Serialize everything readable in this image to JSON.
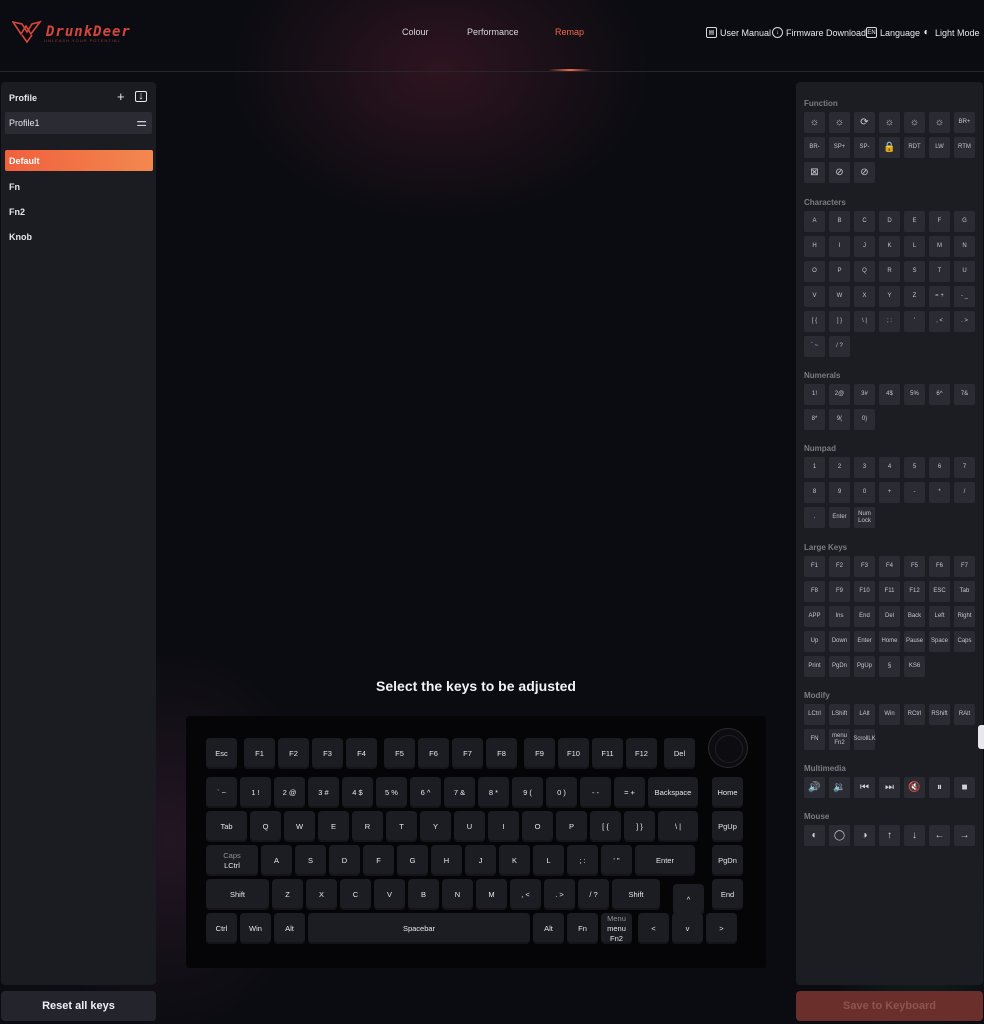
{
  "header": {
    "brand": "DrunkDeer",
    "tagline": "UNLEASH YOUR POTENTIAL",
    "nav": [
      {
        "label": "Colour",
        "active": false
      },
      {
        "label": "Performance",
        "active": false
      },
      {
        "label": "Remap",
        "active": true
      }
    ],
    "utilities": [
      {
        "label": "User Manual",
        "icon": "book-icon"
      },
      {
        "label": "Firmware Download",
        "icon": "download-icon"
      },
      {
        "label": "Language",
        "icon": "language-icon",
        "icon_text": "EN"
      },
      {
        "label": "Light Mode",
        "icon": "moon-icon"
      }
    ]
  },
  "profile": {
    "heading": "Profile",
    "selected": "Profile1",
    "layers": [
      {
        "label": "Default",
        "active": true
      },
      {
        "label": "Fn",
        "active": false
      },
      {
        "label": "Fn2",
        "active": false
      },
      {
        "label": "Knob",
        "active": false
      }
    ],
    "reset_label": "Reset all keys"
  },
  "main": {
    "title": "Select the keys to be adjusted"
  },
  "keyboard": {
    "rows": [
      [
        {
          "t": "Esc"
        },
        {
          "t": "F1"
        },
        {
          "t": "F2"
        },
        {
          "t": "F3"
        },
        {
          "t": "F4"
        },
        {
          "t": "F5"
        },
        {
          "t": "F6"
        },
        {
          "t": "F7"
        },
        {
          "t": "F8"
        },
        {
          "t": "F9"
        },
        {
          "t": "F10"
        },
        {
          "t": "F11"
        },
        {
          "t": "F12"
        },
        {
          "t": "Del"
        }
      ],
      [
        {
          "t": "` ~"
        },
        {
          "t": "1 !"
        },
        {
          "t": "2 @"
        },
        {
          "t": "3 #"
        },
        {
          "t": "4 $"
        },
        {
          "t": "5 %"
        },
        {
          "t": "6 ^"
        },
        {
          "t": "7 &"
        },
        {
          "t": "8 *"
        },
        {
          "t": "9 ("
        },
        {
          "t": "0 )"
        },
        {
          "t": "- -"
        },
        {
          "t": "= +"
        },
        {
          "t": "Backspace"
        },
        {
          "t": "Home"
        }
      ],
      [
        {
          "t": "Tab"
        },
        {
          "t": "Q"
        },
        {
          "t": "W"
        },
        {
          "t": "E"
        },
        {
          "t": "R"
        },
        {
          "t": "T"
        },
        {
          "t": "Y"
        },
        {
          "t": "U"
        },
        {
          "t": "I"
        },
        {
          "t": "O"
        },
        {
          "t": "P"
        },
        {
          "t": "[ {"
        },
        {
          "t": "] }"
        },
        {
          "t": "\\ |"
        },
        {
          "t": "PgUp"
        }
      ],
      [
        {
          "t": "Caps",
          "s": "LCtrl"
        },
        {
          "t": "A"
        },
        {
          "t": "S"
        },
        {
          "t": "D"
        },
        {
          "t": "F"
        },
        {
          "t": "G"
        },
        {
          "t": "H"
        },
        {
          "t": "J"
        },
        {
          "t": "K"
        },
        {
          "t": "L"
        },
        {
          "t": "; :"
        },
        {
          "t": "' \""
        },
        {
          "t": "Enter"
        },
        {
          "t": "PgDn"
        }
      ],
      [
        {
          "t": "Shift"
        },
        {
          "t": "Z"
        },
        {
          "t": "X"
        },
        {
          "t": "C"
        },
        {
          "t": "V"
        },
        {
          "t": "B"
        },
        {
          "t": "N"
        },
        {
          "t": "M"
        },
        {
          "t": ", <"
        },
        {
          "t": ". >"
        },
        {
          "t": "/ ?"
        },
        {
          "t": "Shift"
        },
        {
          "t": "^"
        },
        {
          "t": "End"
        }
      ],
      [
        {
          "t": "Ctrl"
        },
        {
          "t": "Win"
        },
        {
          "t": "Alt"
        },
        {
          "t": "Spacebar"
        },
        {
          "t": "Alt"
        },
        {
          "t": "Fn"
        },
        {
          "t": "Menu",
          "s": "menu Fn2"
        },
        {
          "t": "<"
        },
        {
          "t": "v"
        },
        {
          "t": ">"
        }
      ]
    ]
  },
  "palette": {
    "sections": [
      {
        "title": "Function",
        "keys": [
          {
            "icon": "brightness-icon",
            "g": "☼"
          },
          {
            "icon": "brightness-icon",
            "g": "☼"
          },
          {
            "icon": "cycle-icon",
            "g": "⟳"
          },
          {
            "icon": "brightness-icon",
            "g": "☼"
          },
          {
            "icon": "brightness-icon",
            "g": "☼"
          },
          {
            "icon": "brightness-icon",
            "g": "☼"
          },
          {
            "t": "BR+"
          },
          {
            "t": "BR-"
          },
          {
            "t": "SP+"
          },
          {
            "t": "SP-"
          },
          {
            "icon": "lock-icon",
            "g": "🔒"
          },
          {
            "t": "RDT"
          },
          {
            "t": "LW"
          },
          {
            "t": "RTM"
          },
          {
            "icon": "dash-off-icon",
            "g": "⊠"
          },
          {
            "icon": "disable-icon",
            "g": "⊘"
          },
          {
            "icon": "compass-icon",
            "g": "⊘"
          }
        ]
      },
      {
        "title": "Characters",
        "keys": [
          {
            "t": "A"
          },
          {
            "t": "B"
          },
          {
            "t": "C"
          },
          {
            "t": "D"
          },
          {
            "t": "E"
          },
          {
            "t": "F"
          },
          {
            "t": "G"
          },
          {
            "t": "H"
          },
          {
            "t": "I"
          },
          {
            "t": "J"
          },
          {
            "t": "K"
          },
          {
            "t": "L"
          },
          {
            "t": "M"
          },
          {
            "t": "N"
          },
          {
            "t": "O"
          },
          {
            "t": "P"
          },
          {
            "t": "Q"
          },
          {
            "t": "R"
          },
          {
            "t": "S"
          },
          {
            "t": "T"
          },
          {
            "t": "U"
          },
          {
            "t": "V"
          },
          {
            "t": "W"
          },
          {
            "t": "X"
          },
          {
            "t": "Y"
          },
          {
            "t": "Z"
          },
          {
            "t": "= +"
          },
          {
            "t": "- _"
          },
          {
            "t": "[ {"
          },
          {
            "t": "] }"
          },
          {
            "t": "\\ |"
          },
          {
            "t": "; :"
          },
          {
            "t": "'"
          },
          {
            "t": ", <"
          },
          {
            "t": ". >"
          },
          {
            "t": "` ~"
          },
          {
            "t": "/ ?"
          }
        ]
      },
      {
        "title": "Numerals",
        "keys": [
          {
            "t": "1!"
          },
          {
            "t": "2@"
          },
          {
            "t": "3#"
          },
          {
            "t": "4$"
          },
          {
            "t": "5%"
          },
          {
            "t": "6^"
          },
          {
            "t": "7&"
          },
          {
            "t": "8*"
          },
          {
            "t": "9("
          },
          {
            "t": "0)"
          }
        ]
      },
      {
        "title": "Numpad",
        "keys": [
          {
            "t": "1"
          },
          {
            "t": "2"
          },
          {
            "t": "3"
          },
          {
            "t": "4"
          },
          {
            "t": "5"
          },
          {
            "t": "6"
          },
          {
            "t": "7"
          },
          {
            "t": "8"
          },
          {
            "t": "9"
          },
          {
            "t": "0"
          },
          {
            "t": "+"
          },
          {
            "t": "-"
          },
          {
            "t": "*"
          },
          {
            "t": "/"
          },
          {
            "t": "."
          },
          {
            "t": "Enter"
          },
          {
            "t": "Num Lock"
          }
        ]
      },
      {
        "title": "Large Keys",
        "keys": [
          {
            "t": "F1"
          },
          {
            "t": "F2"
          },
          {
            "t": "F3"
          },
          {
            "t": "F4"
          },
          {
            "t": "F5"
          },
          {
            "t": "F6"
          },
          {
            "t": "F7"
          },
          {
            "t": "F8"
          },
          {
            "t": "F9"
          },
          {
            "t": "F10"
          },
          {
            "t": "F11"
          },
          {
            "t": "F12"
          },
          {
            "t": "ESC"
          },
          {
            "t": "Tab"
          },
          {
            "t": "APP"
          },
          {
            "t": "Ins"
          },
          {
            "t": "End"
          },
          {
            "t": "Del"
          },
          {
            "t": "Back"
          },
          {
            "t": "Left"
          },
          {
            "t": "Right"
          },
          {
            "t": "Up"
          },
          {
            "t": "Down"
          },
          {
            "t": "Enter"
          },
          {
            "t": "Home"
          },
          {
            "t": "Pause"
          },
          {
            "t": "Space"
          },
          {
            "t": "Caps"
          },
          {
            "t": "Print"
          },
          {
            "t": "PgDn"
          },
          {
            "t": "PgUp"
          },
          {
            "t": "§"
          },
          {
            "t": "KS6"
          }
        ]
      },
      {
        "title": "Modify",
        "keys": [
          {
            "t": "LCtrl"
          },
          {
            "t": "LShift"
          },
          {
            "t": "LAlt"
          },
          {
            "t": "Win"
          },
          {
            "t": "RCtrl"
          },
          {
            "t": "RShift"
          },
          {
            "t": "RAlt"
          },
          {
            "t": "FN"
          },
          {
            "t": "menu Fn2"
          },
          {
            "t": "ScrollLK"
          }
        ]
      },
      {
        "title": "Multimedia",
        "keys": [
          {
            "icon": "volume-up-icon",
            "g": "🔊"
          },
          {
            "icon": "volume-down-icon",
            "g": "🔉"
          },
          {
            "icon": "previous-track-icon",
            "g": "⏮"
          },
          {
            "icon": "next-track-icon",
            "g": "⏭"
          },
          {
            "icon": "mute-icon",
            "g": "🔇"
          },
          {
            "icon": "pause-icon",
            "g": "⏸"
          },
          {
            "icon": "stop-icon",
            "g": "■"
          }
        ]
      },
      {
        "title": "Mouse",
        "keys": [
          {
            "icon": "mouse-left-icon",
            "g": "◐"
          },
          {
            "icon": "mouse-middle-icon",
            "g": "◯"
          },
          {
            "icon": "mouse-right-icon",
            "g": "◑"
          },
          {
            "icon": "arrow-up-icon",
            "g": "↑"
          },
          {
            "icon": "arrow-down-icon",
            "g": "↓"
          },
          {
            "icon": "arrow-left-icon",
            "g": "←"
          },
          {
            "icon": "arrow-right-icon",
            "g": "→"
          }
        ]
      }
    ],
    "save_label": "Save to Keyboard"
  },
  "colors": {
    "accent": "#f06a4b",
    "panel": "#1c1d23",
    "key": "#1c1d23",
    "save_disabled": "#6a2f2a"
  }
}
